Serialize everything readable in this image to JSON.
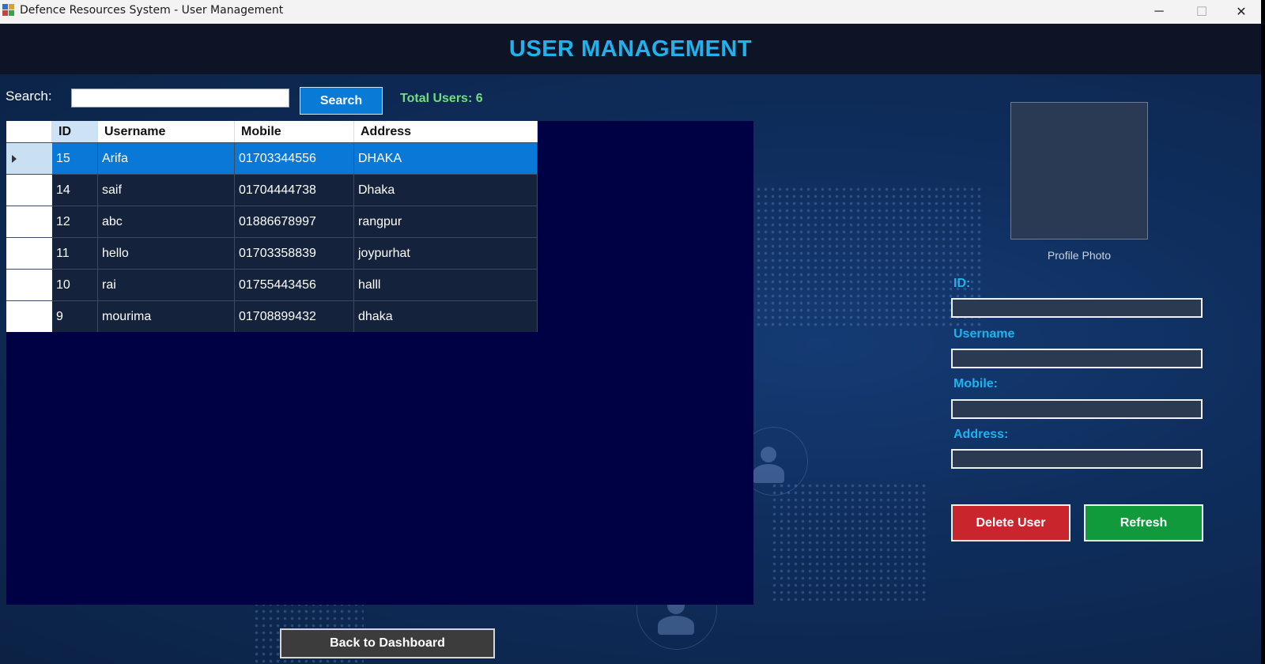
{
  "window": {
    "title": "Defence Resources System - User Management",
    "app_icon": "app-icon",
    "controls": {
      "minimize": "─",
      "maximize": "☐",
      "close": "✕"
    }
  },
  "header": {
    "title": "USER MANAGEMENT",
    "color": "#1fb3ee"
  },
  "search": {
    "label": "Search:",
    "value": "",
    "button_label": "Search",
    "total_users": "Total Users: 6"
  },
  "grid": {
    "columns": [
      "ID",
      "Username",
      "Mobile",
      "Address"
    ],
    "selected_row": 0,
    "rows": [
      {
        "id": "15",
        "username": "Arifa",
        "mobile": "01703344556",
        "address": "DHAKA"
      },
      {
        "id": "14",
        "username": "saif",
        "mobile": "01704444738",
        "address": "Dhaka"
      },
      {
        "id": "12",
        "username": "abc",
        "mobile": "01886678997",
        "address": "rangpur"
      },
      {
        "id": "11",
        "username": "hello",
        "mobile": "01703358839",
        "address": "joypurhat"
      },
      {
        "id": "10",
        "username": "rai",
        "mobile": "01755443456",
        "address": "halll"
      },
      {
        "id": "9",
        "username": "mourima",
        "mobile": "01708899432",
        "address": "dhaka"
      }
    ]
  },
  "profile": {
    "photo_label": "Profile Photo",
    "fields": {
      "id": {
        "label": "ID:",
        "value": ""
      },
      "username": {
        "label": "Username",
        "value": ""
      },
      "mobile": {
        "label": "Mobile:",
        "value": ""
      },
      "address": {
        "label": "Address:",
        "value": ""
      }
    }
  },
  "actions": {
    "delete_label": "Delete User",
    "refresh_label": "Refresh",
    "back_label": "Back to Dashboard"
  },
  "colors": {
    "delete": "#c8262c",
    "refresh": "#119a3b",
    "selected_row": "#0a78d6",
    "total_users": "#6ee07b"
  }
}
